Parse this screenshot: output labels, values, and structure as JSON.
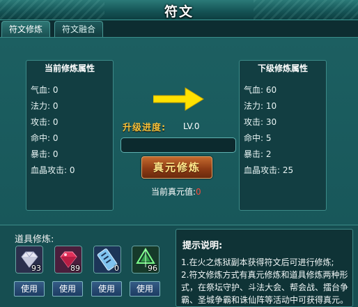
{
  "window": {
    "title": "符文"
  },
  "tabs": [
    {
      "label": "符文修炼",
      "active": true
    },
    {
      "label": "符文融合",
      "active": false
    }
  ],
  "current_panel": {
    "header": "当前修炼属性",
    "stats": [
      {
        "label": "气血:",
        "value": "0"
      },
      {
        "label": "法力:",
        "value": "0"
      },
      {
        "label": "攻击:",
        "value": "0"
      },
      {
        "label": "命中:",
        "value": "0"
      },
      {
        "label": "暴击:",
        "value": "0"
      },
      {
        "label": "血晶攻击:",
        "value": "0"
      }
    ]
  },
  "next_panel": {
    "header": "下级修炼属性",
    "stats": [
      {
        "label": "气血:",
        "value": "60"
      },
      {
        "label": "法力:",
        "value": "10"
      },
      {
        "label": "攻击:",
        "value": "30"
      },
      {
        "label": "命中:",
        "value": "5"
      },
      {
        "label": "暴击:",
        "value": "2"
      },
      {
        "label": "血晶攻击:",
        "value": "25"
      }
    ]
  },
  "progress": {
    "label": "升级进度:",
    "level": "LV.0",
    "fraction": 0
  },
  "cultivate_button": {
    "label": "真元修炼"
  },
  "current_zhenyuan": {
    "label": "当前真元值:",
    "value": "0"
  },
  "items": {
    "label": "道具修炼:",
    "list": [
      {
        "icon": "white-gem-icon",
        "count": "93",
        "button": "使用"
      },
      {
        "icon": "red-gem-icon",
        "count": "89",
        "button": "使用"
      },
      {
        "icon": "blue-talisman-icon",
        "count": "0",
        "button": "使用"
      },
      {
        "icon": "green-crystal-icon",
        "count": "96",
        "button": "使用"
      }
    ]
  },
  "hint": {
    "title": "提示说明:",
    "lines": [
      "1.在火之炼狱副本获得符文后可进行修炼;",
      "2.符文修炼方式有真元修炼和道具修炼两种形",
      "式，在祭坛守护、斗法大会、帮会战、擂台争",
      "霸、圣城争霸和诛仙阵等活动中可获得真元。"
    ]
  },
  "colors": {
    "panel_bg": "#123e42",
    "accent_gold": "#f6c23c",
    "arrow_yellow": "#ffe100",
    "zhenyuan_value": "#ff4a3c"
  }
}
